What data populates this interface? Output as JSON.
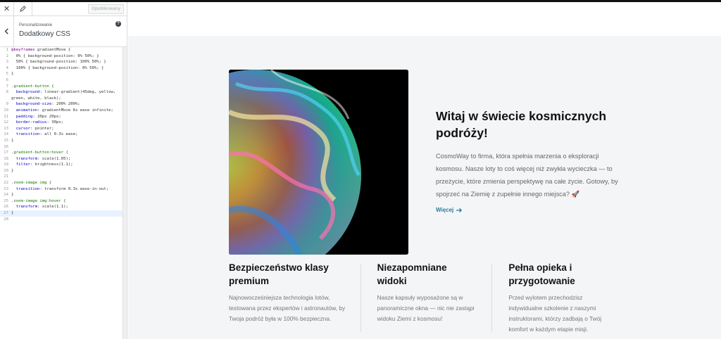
{
  "customizer": {
    "close_icon": "close-icon",
    "edit_icon": "pencil-icon",
    "publish_label": "Opublikowany",
    "section_parent": "Personalizowanie",
    "section_title": "Dodatkowy CSS",
    "help_icon": "help-icon",
    "back_icon": "chevron-left-icon"
  },
  "css_code": [
    "@keyframes gradientMove {",
    "  0% { background-position: 0% 50%; }",
    "  50% { background-position: 100% 50%; }",
    "  100% { background-position: 0% 50%; }",
    "}",
    "",
    ".gradient-button {",
    "  background: linear-gradient(45deg, yellow,",
    "green, white, black);",
    "  background-size: 200% 200%;",
    "  animation: gradientMove 6s ease infinite;",
    "  padding: 20px 20px;",
    "  border-radius: 30px;",
    "  cursor: pointer;",
    "  transition: all 0.3s ease;",
    "}",
    "",
    ".gradient-button:hover {",
    "  transform: scale(1.05);",
    "  filter: brightness(1.1);",
    "}",
    "",
    ".zoom-image img {",
    "  transition: transform 0.3s ease-in-out;",
    "}",
    ".zoom-image img:hover {",
    "  transform: scale(1.1);",
    "}",
    ""
  ],
  "css_line_numbers": [
    "1",
    "2",
    "3",
    "4",
    "5",
    "6",
    "7",
    "8",
    "",
    "9",
    "10",
    "11",
    "12",
    "13",
    "14",
    "15",
    "16",
    "17",
    "18",
    "19",
    "20",
    "21",
    "22",
    "23",
    "24",
    "25",
    "26",
    "27",
    "28"
  ],
  "hero": {
    "title": "Witaj w świecie kosmicznych podróży!",
    "description": "CosmoWay to firma, która spełnia marzenia o eksploracji kosmosu. Nasze loty to coś więcej niż zwykła wycieczka — to przeżycie, które zmienia perspektywę na całe życie. Gotowy, by spojrzeć na Ziemię z zupełnie innego miejsca?",
    "emoji": "🚀",
    "link_label": "Więcej",
    "link_icon": "arrow-right-icon",
    "link_color": "#2a7a9c",
    "image_alt": "planet-image"
  },
  "features": [
    {
      "title": "Bezpieczeństwo klasy premium",
      "description": "Najnowocześniejsza technologia lotów, testowana przez ekspertów i astronautów, by Twoja podróż była w 100% bezpieczna."
    },
    {
      "title": "Niezapomniane widoki",
      "description": "Nasze kapsuły wyposażone są w panoramiczne okna — nic nie zastąpi widoku Ziemi z kosmosu!"
    },
    {
      "title": "Pełna opieka i przygotowanie",
      "description": "Przed wylotem przechodzisz indywidualne szkolenie z naszymi instruktorami, którzy zadbają o Twój komfort w każdym etapie misji."
    }
  ]
}
